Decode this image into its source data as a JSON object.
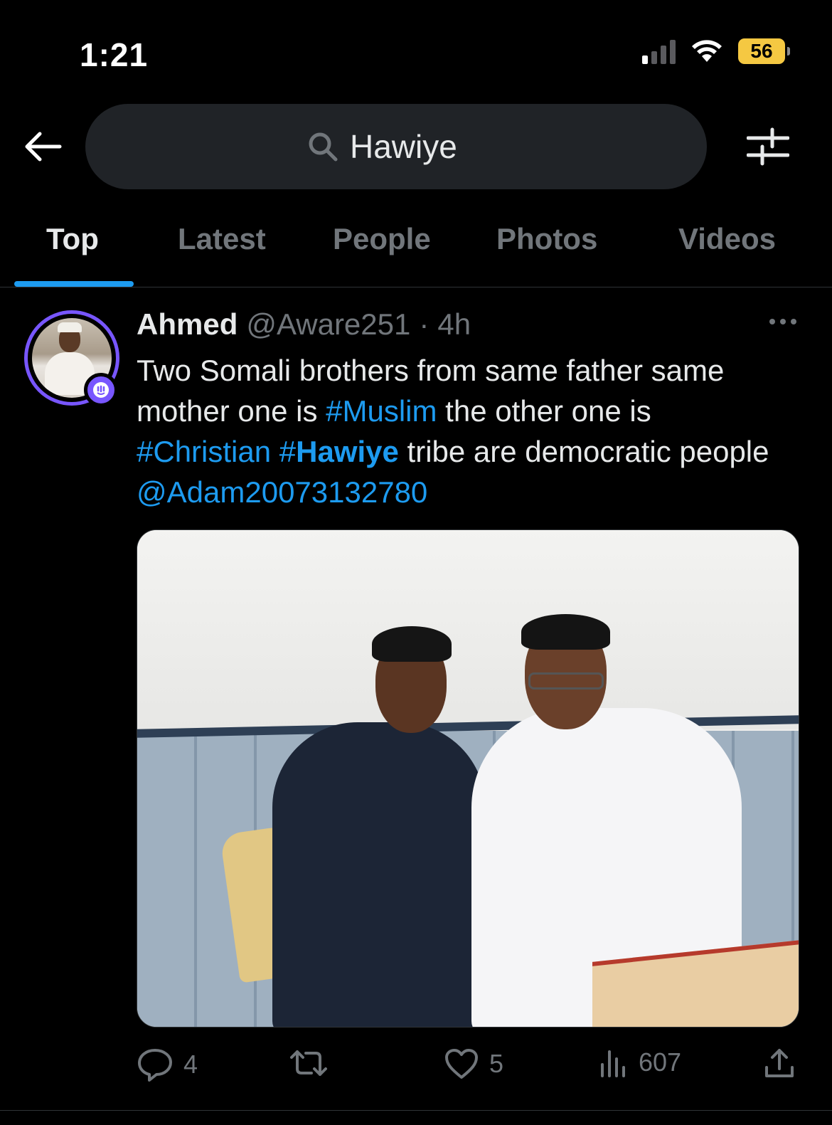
{
  "status_bar": {
    "time": "1:21",
    "battery": "56"
  },
  "search": {
    "value": "Hawiye",
    "icons": [
      "back-arrow-icon",
      "search-icon",
      "filter-icon"
    ]
  },
  "tabs": [
    {
      "label": "Top",
      "active": true
    },
    {
      "label": "Latest",
      "active": false
    },
    {
      "label": "People",
      "active": false
    },
    {
      "label": "Photos",
      "active": false
    },
    {
      "label": "Videos",
      "active": false
    }
  ],
  "tweet": {
    "display_name": "Ahmed",
    "handle": "@Aware251",
    "separator": "·",
    "time_ago": "4h",
    "text": {
      "part1": "Two Somali brothers from same father same mother one is ",
      "hashtag_muslim": "#Muslim",
      "part2": " the other one is ",
      "hashtag_christian": "#Christian",
      "hashtag_hawiye_prefix": "#",
      "hashtag_hawiye_term": "Hawiye",
      "part3": " tribe are democratic people ",
      "mention": "@Adam20073132780"
    },
    "actions": {
      "replies": "4",
      "retweets": "",
      "likes": "5",
      "views": "607"
    }
  },
  "colors": {
    "background": "#000000",
    "accent": "#1d9bf0",
    "spaces_ring": "#7856ff",
    "muted_text": "#71767b",
    "battery": "#f5c842"
  }
}
